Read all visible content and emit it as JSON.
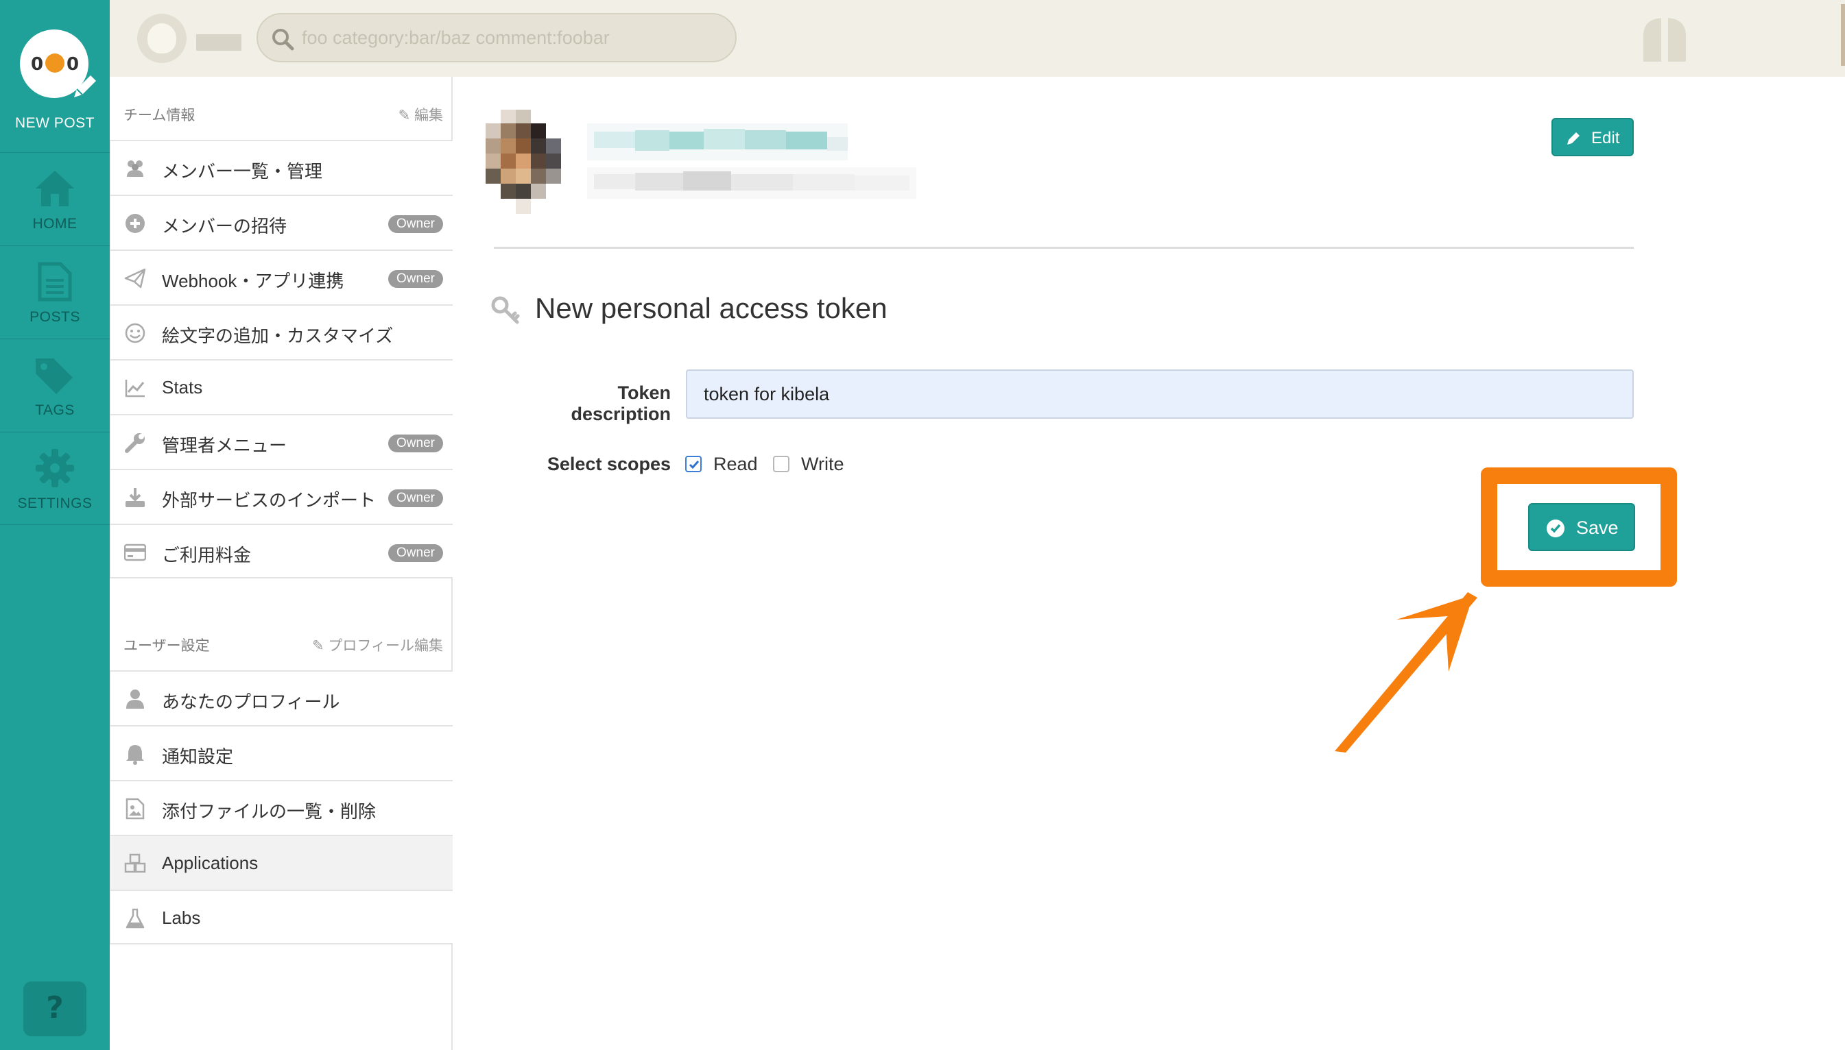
{
  "rail": {
    "new_post": "NEW POST",
    "items": [
      {
        "label": "HOME",
        "icon": "home-icon"
      },
      {
        "label": "POSTS",
        "icon": "document-icon"
      },
      {
        "label": "TAGS",
        "icon": "tag-icon"
      },
      {
        "label": "SETTINGS",
        "icon": "gear-icon"
      }
    ],
    "help": "?"
  },
  "topbar": {
    "search_placeholder": "foo category:bar/baz comment:foobar"
  },
  "sidebar": {
    "team_section": {
      "title": "チーム情報",
      "action": "編集"
    },
    "team_items": [
      {
        "label": "メンバー一覧・管理",
        "icon": "users-icon"
      },
      {
        "label": "メンバーの招待",
        "icon": "plus-circle-icon",
        "badge": "Owner"
      },
      {
        "label": "Webhook・アプリ連携",
        "icon": "paper-plane-icon",
        "badge": "Owner"
      },
      {
        "label": "絵文字の追加・カスタマイズ",
        "icon": "smile-icon"
      },
      {
        "label": "Stats",
        "icon": "chart-icon"
      },
      {
        "label": "管理者メニュー",
        "icon": "wrench-icon",
        "badge": "Owner"
      },
      {
        "label": "外部サービスのインポート",
        "icon": "download-icon",
        "badge": "Owner"
      },
      {
        "label": "ご利用料金",
        "icon": "credit-card-icon",
        "badge": "Owner"
      }
    ],
    "user_section": {
      "title": "ユーザー設定",
      "action": "プロフィール編集"
    },
    "user_items": [
      {
        "label": "あなたのプロフィール",
        "icon": "user-icon"
      },
      {
        "label": "通知設定",
        "icon": "bell-icon"
      },
      {
        "label": "添付ファイルの一覧・削除",
        "icon": "file-image-icon"
      },
      {
        "label": "Applications",
        "icon": "cubes-icon",
        "active": true
      },
      {
        "label": "Labs",
        "icon": "flask-icon"
      }
    ]
  },
  "main": {
    "edit_label": "Edit",
    "form_title": "New personal access token",
    "description_label": "Token description",
    "description_value": "token for kibela",
    "scopes_label": "Select scopes",
    "scopes": [
      {
        "label": "Read",
        "checked": true
      },
      {
        "label": "Write",
        "checked": false
      }
    ],
    "save_label": "Save"
  },
  "colors": {
    "brand": "#1fa098",
    "topbar": "#f2f0e6",
    "annotation": "#f77f0d",
    "badge": "#9a9a9a"
  }
}
